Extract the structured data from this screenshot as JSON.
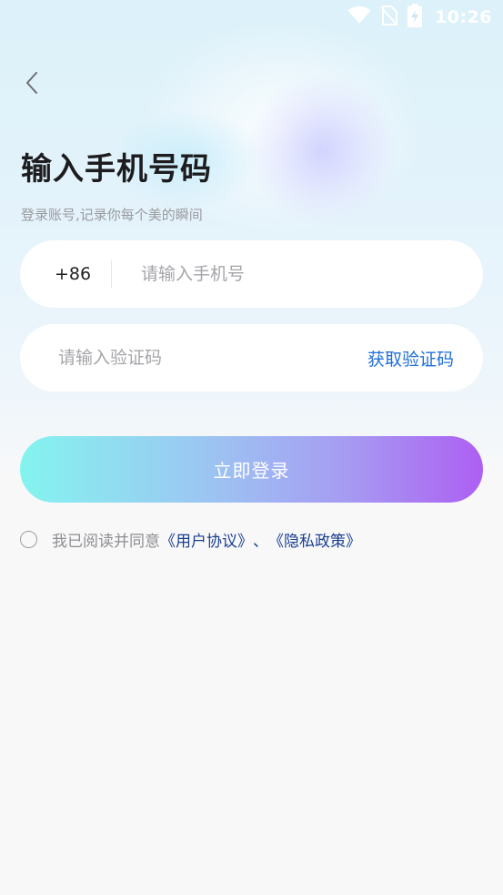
{
  "status_bar": {
    "time": "10:26",
    "icons": [
      "wifi-icon",
      "no-sim-icon",
      "battery-charging-icon"
    ]
  },
  "header": {
    "back_icon": "chevron-left-icon",
    "title": "输入手机号码",
    "subtitle": "登录账号,记录你每个美的瞬间"
  },
  "phone_field": {
    "country_code": "+86",
    "placeholder": "请输入手机号",
    "value": ""
  },
  "code_field": {
    "placeholder": "请输入验证码",
    "value": "",
    "get_code_label": "获取验证码"
  },
  "login_button": {
    "label": "立即登录"
  },
  "agreement": {
    "checked": false,
    "prefix": "我已阅读并同意",
    "user_agreement": "《用户协议》",
    "separator": "、",
    "privacy_policy": "《隐私政策》"
  },
  "colors": {
    "accent_link": "#1e6fd8",
    "agreement_link": "#1a3f8f",
    "button_gradient_start": "#84f4ef",
    "button_gradient_end": "#ad5ff2"
  }
}
